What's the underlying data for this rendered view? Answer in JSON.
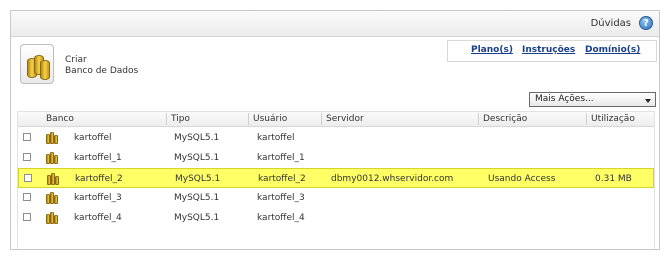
{
  "header": {
    "help_label": "Dúvidas",
    "help_icon": "?"
  },
  "create": {
    "line1": "Criar",
    "line2": "Banco de Dados"
  },
  "links": [
    "Plano(s)",
    "Instruções",
    "Domínio(s)"
  ],
  "actions": {
    "selected": "Mais Ações..."
  },
  "table": {
    "columns": [
      "Banco",
      "Tipo",
      "Usuário",
      "Servidor",
      "Descrição",
      "Utilização"
    ],
    "rows": [
      {
        "banco": "kartoffel",
        "tipo": "MySQL5.1",
        "usuario": "kartoffel",
        "servidor": "",
        "descricao": "",
        "utilizacao": ""
      },
      {
        "banco": "kartoffel_1",
        "tipo": "MySQL5.1",
        "usuario": "kartoffel_1",
        "servidor": "",
        "descricao": "",
        "utilizacao": ""
      },
      {
        "banco": "kartoffel_2",
        "tipo": "MySQL5.1",
        "usuario": "kartoffel_2",
        "servidor": "dbmy0012.whservidor.com",
        "descricao": "Usando Access",
        "utilizacao": "0.31 MB"
      },
      {
        "banco": "kartoffel_3",
        "tipo": "MySQL5.1",
        "usuario": "kartoffel_3",
        "servidor": "",
        "descricao": "",
        "utilizacao": ""
      },
      {
        "banco": "kartoffel_4",
        "tipo": "MySQL5.1",
        "usuario": "kartoffel_4",
        "servidor": "",
        "descricao": "",
        "utilizacao": ""
      }
    ]
  },
  "colors": {
    "highlight": "#ffff66",
    "link": "#1a3f8a"
  }
}
